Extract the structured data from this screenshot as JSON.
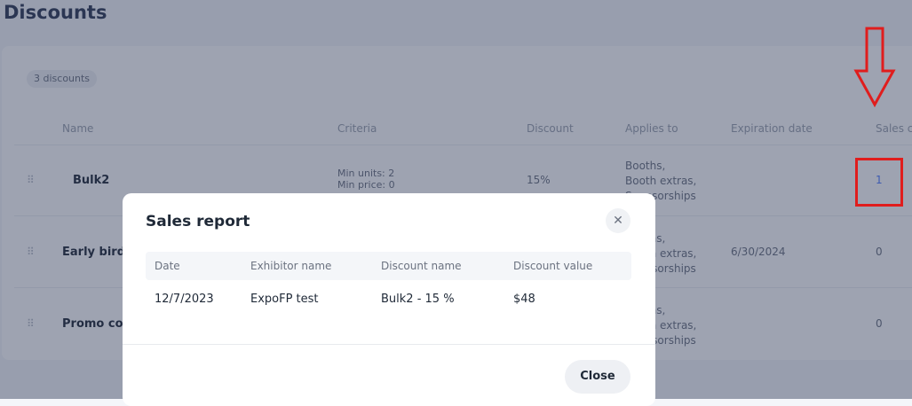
{
  "page": {
    "title": "Discounts"
  },
  "discounts": {
    "count_label": "3 discounts",
    "columns": [
      "Name",
      "Criteria",
      "Discount",
      "Applies to",
      "Expiration date",
      "Sales c"
    ],
    "rows": [
      {
        "name": "Bulk2",
        "criteria": [
          "Min units: 2",
          "Min price: 0"
        ],
        "discount": "15%",
        "applies_to": [
          "Booths,",
          "Booth extras,",
          "Sponsorships"
        ],
        "expiration": "",
        "sales": "1"
      },
      {
        "name": "Early bird",
        "criteria": [],
        "discount": "",
        "applies_to": [
          "Booths,",
          "Booth extras,",
          "Sponsorships"
        ],
        "expiration": "6/30/2024",
        "sales": "0"
      },
      {
        "name": "Promo co",
        "criteria": [],
        "discount": "",
        "applies_to": [
          "Booths,",
          "Booth extras,",
          "Sponsorships"
        ],
        "expiration": "",
        "sales": "0"
      }
    ]
  },
  "modal": {
    "title": "Sales report",
    "close_icon": "close-icon",
    "table": {
      "columns": [
        "Date",
        "Exhibitor name",
        "Discount name",
        "Discount value"
      ],
      "rows": [
        {
          "date": "12/7/2023",
          "exhibitor": "ExpoFP test",
          "discount_name": "Bulk2 - 15 %",
          "value": "$48"
        }
      ]
    },
    "close_label": "Close"
  },
  "colors": {
    "annotation": "#e01d1d",
    "link": "#4f7cff",
    "overlay": "#273453"
  }
}
